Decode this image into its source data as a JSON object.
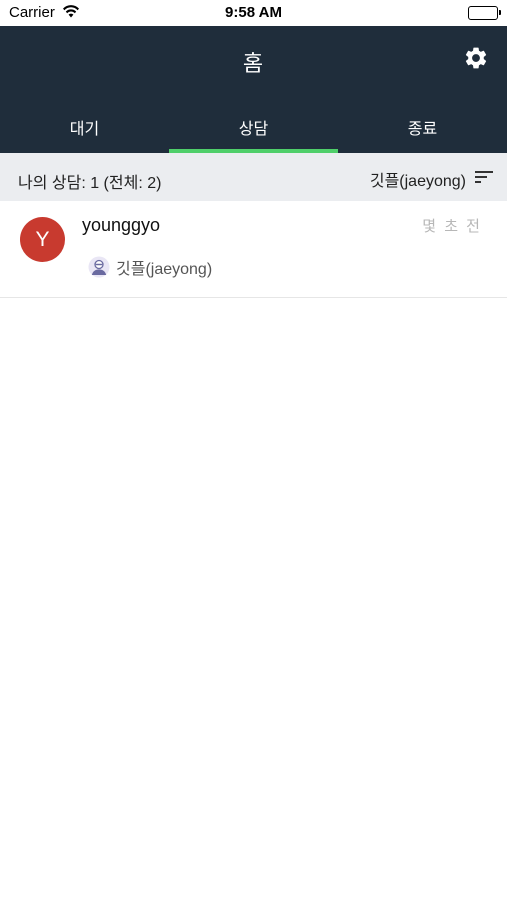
{
  "status_bar": {
    "carrier": "Carrier",
    "time": "9:58 AM",
    "wifi_icon": "wifi-icon",
    "battery_icon": "battery-icon"
  },
  "header": {
    "title": "홈",
    "settings_icon": "gear-icon",
    "background_color": "#1f2d3b"
  },
  "tabs": [
    {
      "label": "대기",
      "active": false
    },
    {
      "label": "상담",
      "active": true
    },
    {
      "label": "종료",
      "active": false
    }
  ],
  "tab_indicator_color": "#4fcf6a",
  "summary": {
    "my_count_text": "나의 상담: 1 (전체: 2)",
    "filter_label": "깃플(jaeyong)",
    "filter_icon": "sort-icon"
  },
  "conversations": [
    {
      "avatar_letter": "Y",
      "avatar_color": "#c83a2f",
      "name": "younggyo",
      "time": "몇 초 전",
      "assignee": "깃플(jaeyong)",
      "assignee_icon": "agent-avatar-icon"
    }
  ]
}
